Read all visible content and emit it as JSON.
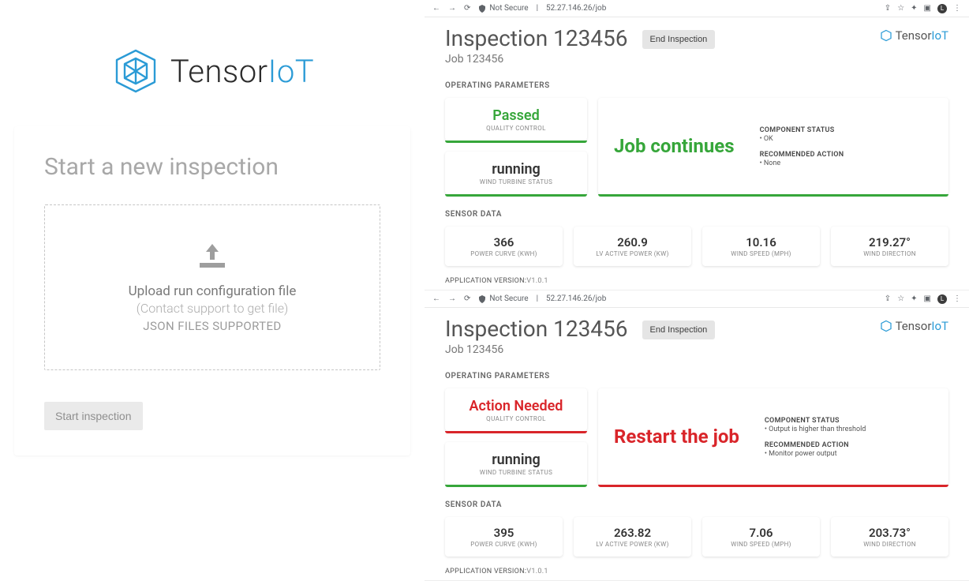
{
  "brand": {
    "name": "Tensor",
    "suffix": "IoT"
  },
  "left": {
    "title": "Start a new inspection",
    "dz_line1": "Upload run configuration file",
    "dz_line2": "(Contact support to get file)",
    "dz_line3": "JSON FILES SUPPORTED",
    "start_btn": "Start inspection"
  },
  "chrome": {
    "not_secure": "Not Secure",
    "url": "52.27.146.26/job"
  },
  "app": {
    "title": "Inspection 123456",
    "job": "Job 123456",
    "end_btn": "End Inspection",
    "op_label": "OPERATING PARAMETERS",
    "sensor_label": "SENSOR DATA",
    "footer_label": "APPLICATION VERSION:",
    "footer_ver": "V1.0.1",
    "sensor_labels": {
      "power_curve": "POWER CURVE (KWH)",
      "lv_active": "LV ACTIVE POWER (KW)",
      "wind_speed": "WIND SPEED (MPH)",
      "wind_dir": "WIND DIRECTION"
    },
    "meta_labels": {
      "component": "COMPONENT STATUS",
      "recommended": "RECOMMENDED ACTION"
    }
  },
  "views": [
    {
      "quality": {
        "value": "Passed",
        "sub": "QUALITY CONTROL",
        "tone": "green"
      },
      "turbine": {
        "value": "running",
        "sub": "WIND TURBINE STATUS",
        "tone": "green"
      },
      "action": {
        "headline": "Job continues",
        "tone": "green",
        "component": "• OK",
        "recommended": "• None"
      },
      "sensors": {
        "power_curve": "366",
        "lv_active": "260.9",
        "wind_speed": "10.16",
        "wind_dir": "219.27°"
      }
    },
    {
      "quality": {
        "value": "Action Needed",
        "sub": "QUALITY CONTROL",
        "tone": "red"
      },
      "turbine": {
        "value": "running",
        "sub": "WIND TURBINE STATUS",
        "tone": "green"
      },
      "action": {
        "headline": "Restart the job",
        "tone": "red",
        "component": "• Output is higher than threshold",
        "recommended": "• Monitor power output"
      },
      "sensors": {
        "power_curve": "395",
        "lv_active": "263.82",
        "wind_speed": "7.06",
        "wind_dir": "203.73°"
      }
    }
  ]
}
